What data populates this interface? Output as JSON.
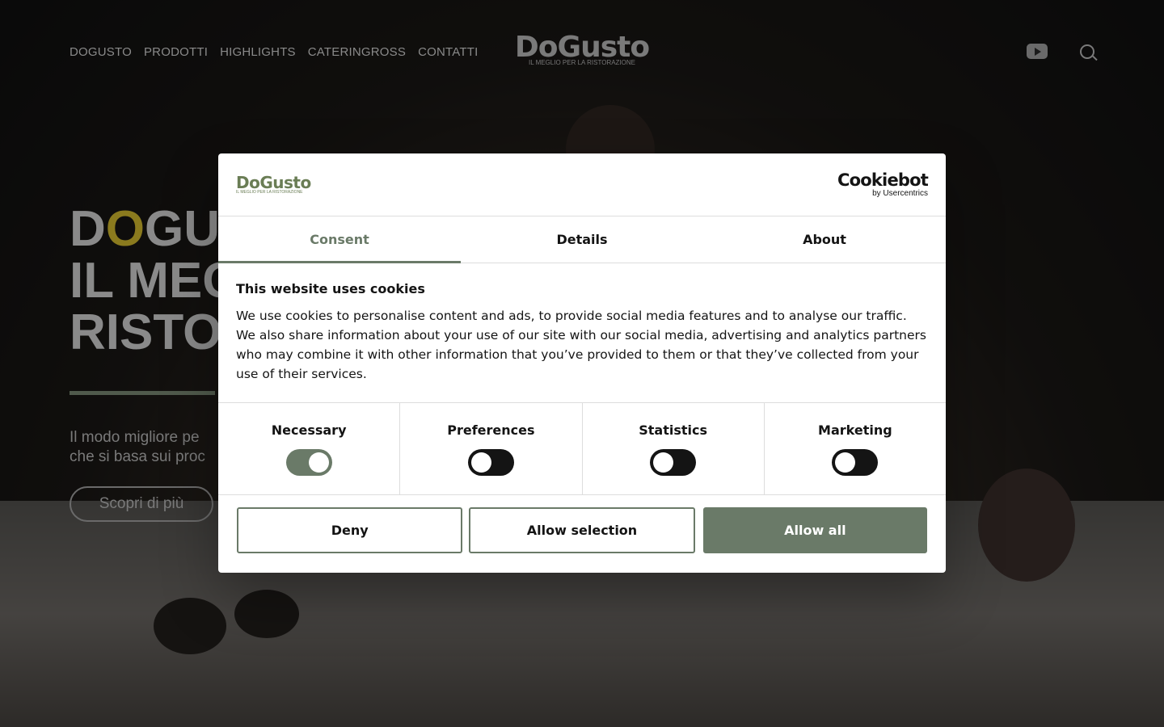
{
  "nav": {
    "items": [
      "DOGUSTO",
      "PRODOTTI",
      "HIGHLIGHTS",
      "CATERINGROSS",
      "CONTATTI"
    ]
  },
  "brand": {
    "name": "DoGusto",
    "tagline": "IL MEGLIO PER LA RISTORAZIONE"
  },
  "icons": {
    "youtube": "youtube-icon",
    "search": "search-icon"
  },
  "hero": {
    "title_line1_d": "D",
    "title_line1_o": "O",
    "title_line1_rest": "GU",
    "title_line2": "IL MEG",
    "title_line3": "RISTO",
    "subtitle_line1": "Il modo migliore pe",
    "subtitle_line2": "che si basa sui proc",
    "button": "Scopri di più"
  },
  "dialog": {
    "logo": "DoGusto",
    "logo_tag": "IL MEGLIO PER LA RISTORAZIONE",
    "provider": "Cookiebot",
    "provider_sub": "by Usercentrics",
    "tabs": [
      "Consent",
      "Details",
      "About"
    ],
    "active_tab": "Consent",
    "heading": "This website uses cookies",
    "text": "We use cookies to personalise content and ads, to provide social media features and to analyse our traffic. We also share information about your use of our site with our social media, advertising and analytics partners who may combine it with other information that you’ve provided to them or that they’ve collected from your use of their services.",
    "toggles": [
      {
        "label": "Necessary",
        "on": true
      },
      {
        "label": "Preferences",
        "on": false
      },
      {
        "label": "Statistics",
        "on": false
      },
      {
        "label": "Marketing",
        "on": false
      }
    ],
    "buttons": {
      "deny": "Deny",
      "allow_selection": "Allow selection",
      "allow_all": "Allow all"
    },
    "accent_color": "#6a7a68"
  }
}
